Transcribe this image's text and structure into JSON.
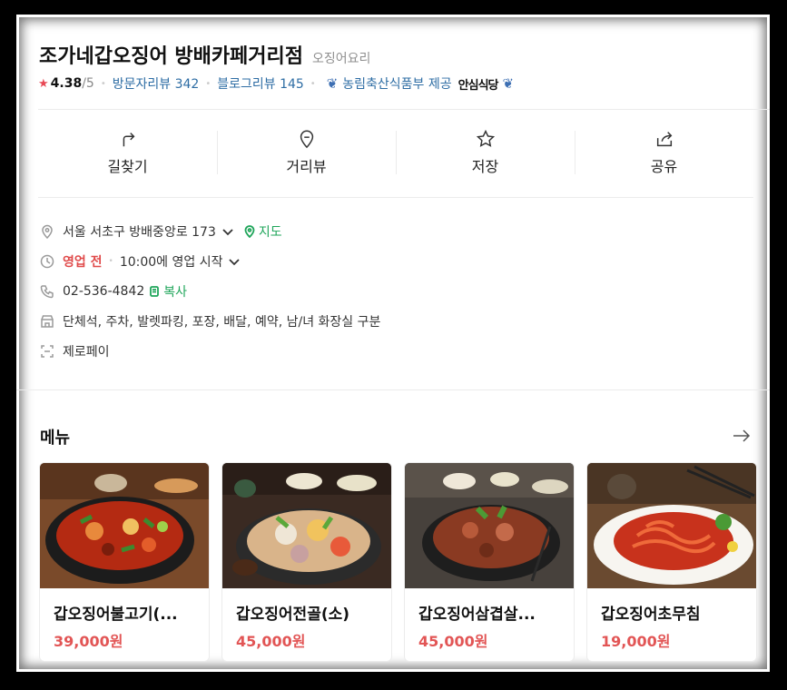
{
  "place": {
    "name": "조가네갑오징어 방배카페거리점",
    "category": "오징어요리",
    "rating": "4.38",
    "rating_max": "/5",
    "visitor_reviews": "방문자리뷰 342",
    "blog_reviews": "블로그리뷰 145",
    "award_text": "농림축산식품부 제공",
    "award_badge": "안심식당"
  },
  "actions": [
    {
      "label": "길찾기",
      "icon": "directions-icon"
    },
    {
      "label": "거리뷰",
      "icon": "location-pin-icon"
    },
    {
      "label": "저장",
      "icon": "star-icon"
    },
    {
      "label": "공유",
      "icon": "share-icon"
    }
  ],
  "info": {
    "address": "서울 서초구 방배중앙로 173",
    "map_label": "지도",
    "status": "영업 전",
    "hours": "10:00에 영업 시작",
    "phone": "02-536-4842",
    "copy_label": "복사",
    "amenities": "단체석, 주차, 발렛파킹, 포장, 배달, 예약, 남/녀 화장실 구분",
    "payment": "제로페이"
  },
  "menu": {
    "heading": "메뉴",
    "items": [
      {
        "name": "갑오징어불고기(...",
        "price": "39,000원"
      },
      {
        "name": "갑오징어전골(소)",
        "price": "45,000원"
      },
      {
        "name": "갑오징어삼겹살...",
        "price": "45,000원"
      },
      {
        "name": "갑오징어초무침",
        "price": "19,000원"
      }
    ]
  },
  "colors": {
    "link": "#2e6da4",
    "status_red": "#e04a4a",
    "price_red": "#e25555",
    "green": "#1fa55a",
    "star": "#e84855"
  }
}
